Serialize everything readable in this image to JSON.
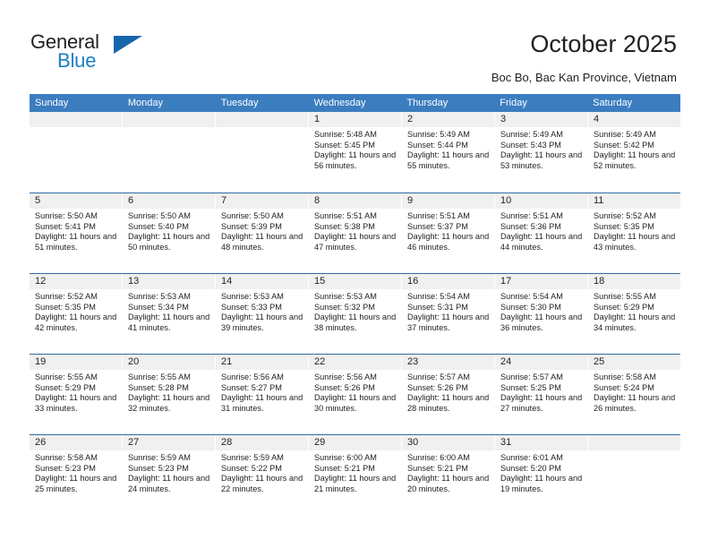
{
  "brand": {
    "name_top": "General",
    "name_bottom": "Blue",
    "color_dark": "#231f20",
    "color_blue": "#1a7fc1",
    "triangle_color": "#1565ad"
  },
  "header": {
    "title": "October 2025",
    "subtitle": "Boc Bo, Bac Kan Province, Vietnam"
  },
  "calendar": {
    "header_bg": "#3b7dbf",
    "row_rule": "#2e6da4",
    "daynum_bg": "#f0f0f0",
    "weekdays": [
      "Sunday",
      "Monday",
      "Tuesday",
      "Wednesday",
      "Thursday",
      "Friday",
      "Saturday"
    ],
    "weeks": [
      [
        {
          "day": "",
          "empty": true
        },
        {
          "day": "",
          "empty": true
        },
        {
          "day": "",
          "empty": true
        },
        {
          "day": "1",
          "sunrise": "Sunrise: 5:48 AM",
          "sunset": "Sunset: 5:45 PM",
          "daylight": "Daylight: 11 hours and 56 minutes."
        },
        {
          "day": "2",
          "sunrise": "Sunrise: 5:49 AM",
          "sunset": "Sunset: 5:44 PM",
          "daylight": "Daylight: 11 hours and 55 minutes."
        },
        {
          "day": "3",
          "sunrise": "Sunrise: 5:49 AM",
          "sunset": "Sunset: 5:43 PM",
          "daylight": "Daylight: 11 hours and 53 minutes."
        },
        {
          "day": "4",
          "sunrise": "Sunrise: 5:49 AM",
          "sunset": "Sunset: 5:42 PM",
          "daylight": "Daylight: 11 hours and 52 minutes."
        }
      ],
      [
        {
          "day": "5",
          "sunrise": "Sunrise: 5:50 AM",
          "sunset": "Sunset: 5:41 PM",
          "daylight": "Daylight: 11 hours and 51 minutes."
        },
        {
          "day": "6",
          "sunrise": "Sunrise: 5:50 AM",
          "sunset": "Sunset: 5:40 PM",
          "daylight": "Daylight: 11 hours and 50 minutes."
        },
        {
          "day": "7",
          "sunrise": "Sunrise: 5:50 AM",
          "sunset": "Sunset: 5:39 PM",
          "daylight": "Daylight: 11 hours and 48 minutes."
        },
        {
          "day": "8",
          "sunrise": "Sunrise: 5:51 AM",
          "sunset": "Sunset: 5:38 PM",
          "daylight": "Daylight: 11 hours and 47 minutes."
        },
        {
          "day": "9",
          "sunrise": "Sunrise: 5:51 AM",
          "sunset": "Sunset: 5:37 PM",
          "daylight": "Daylight: 11 hours and 46 minutes."
        },
        {
          "day": "10",
          "sunrise": "Sunrise: 5:51 AM",
          "sunset": "Sunset: 5:36 PM",
          "daylight": "Daylight: 11 hours and 44 minutes."
        },
        {
          "day": "11",
          "sunrise": "Sunrise: 5:52 AM",
          "sunset": "Sunset: 5:35 PM",
          "daylight": "Daylight: 11 hours and 43 minutes."
        }
      ],
      [
        {
          "day": "12",
          "sunrise": "Sunrise: 5:52 AM",
          "sunset": "Sunset: 5:35 PM",
          "daylight": "Daylight: 11 hours and 42 minutes."
        },
        {
          "day": "13",
          "sunrise": "Sunrise: 5:53 AM",
          "sunset": "Sunset: 5:34 PM",
          "daylight": "Daylight: 11 hours and 41 minutes."
        },
        {
          "day": "14",
          "sunrise": "Sunrise: 5:53 AM",
          "sunset": "Sunset: 5:33 PM",
          "daylight": "Daylight: 11 hours and 39 minutes."
        },
        {
          "day": "15",
          "sunrise": "Sunrise: 5:53 AM",
          "sunset": "Sunset: 5:32 PM",
          "daylight": "Daylight: 11 hours and 38 minutes."
        },
        {
          "day": "16",
          "sunrise": "Sunrise: 5:54 AM",
          "sunset": "Sunset: 5:31 PM",
          "daylight": "Daylight: 11 hours and 37 minutes."
        },
        {
          "day": "17",
          "sunrise": "Sunrise: 5:54 AM",
          "sunset": "Sunset: 5:30 PM",
          "daylight": "Daylight: 11 hours and 36 minutes."
        },
        {
          "day": "18",
          "sunrise": "Sunrise: 5:55 AM",
          "sunset": "Sunset: 5:29 PM",
          "daylight": "Daylight: 11 hours and 34 minutes."
        }
      ],
      [
        {
          "day": "19",
          "sunrise": "Sunrise: 5:55 AM",
          "sunset": "Sunset: 5:29 PM",
          "daylight": "Daylight: 11 hours and 33 minutes."
        },
        {
          "day": "20",
          "sunrise": "Sunrise: 5:55 AM",
          "sunset": "Sunset: 5:28 PM",
          "daylight": "Daylight: 11 hours and 32 minutes."
        },
        {
          "day": "21",
          "sunrise": "Sunrise: 5:56 AM",
          "sunset": "Sunset: 5:27 PM",
          "daylight": "Daylight: 11 hours and 31 minutes."
        },
        {
          "day": "22",
          "sunrise": "Sunrise: 5:56 AM",
          "sunset": "Sunset: 5:26 PM",
          "daylight": "Daylight: 11 hours and 30 minutes."
        },
        {
          "day": "23",
          "sunrise": "Sunrise: 5:57 AM",
          "sunset": "Sunset: 5:26 PM",
          "daylight": "Daylight: 11 hours and 28 minutes."
        },
        {
          "day": "24",
          "sunrise": "Sunrise: 5:57 AM",
          "sunset": "Sunset: 5:25 PM",
          "daylight": "Daylight: 11 hours and 27 minutes."
        },
        {
          "day": "25",
          "sunrise": "Sunrise: 5:58 AM",
          "sunset": "Sunset: 5:24 PM",
          "daylight": "Daylight: 11 hours and 26 minutes."
        }
      ],
      [
        {
          "day": "26",
          "sunrise": "Sunrise: 5:58 AM",
          "sunset": "Sunset: 5:23 PM",
          "daylight": "Daylight: 11 hours and 25 minutes."
        },
        {
          "day": "27",
          "sunrise": "Sunrise: 5:59 AM",
          "sunset": "Sunset: 5:23 PM",
          "daylight": "Daylight: 11 hours and 24 minutes."
        },
        {
          "day": "28",
          "sunrise": "Sunrise: 5:59 AM",
          "sunset": "Sunset: 5:22 PM",
          "daylight": "Daylight: 11 hours and 22 minutes."
        },
        {
          "day": "29",
          "sunrise": "Sunrise: 6:00 AM",
          "sunset": "Sunset: 5:21 PM",
          "daylight": "Daylight: 11 hours and 21 minutes."
        },
        {
          "day": "30",
          "sunrise": "Sunrise: 6:00 AM",
          "sunset": "Sunset: 5:21 PM",
          "daylight": "Daylight: 11 hours and 20 minutes."
        },
        {
          "day": "31",
          "sunrise": "Sunrise: 6:01 AM",
          "sunset": "Sunset: 5:20 PM",
          "daylight": "Daylight: 11 hours and 19 minutes."
        },
        {
          "day": "",
          "empty": true
        }
      ]
    ]
  }
}
